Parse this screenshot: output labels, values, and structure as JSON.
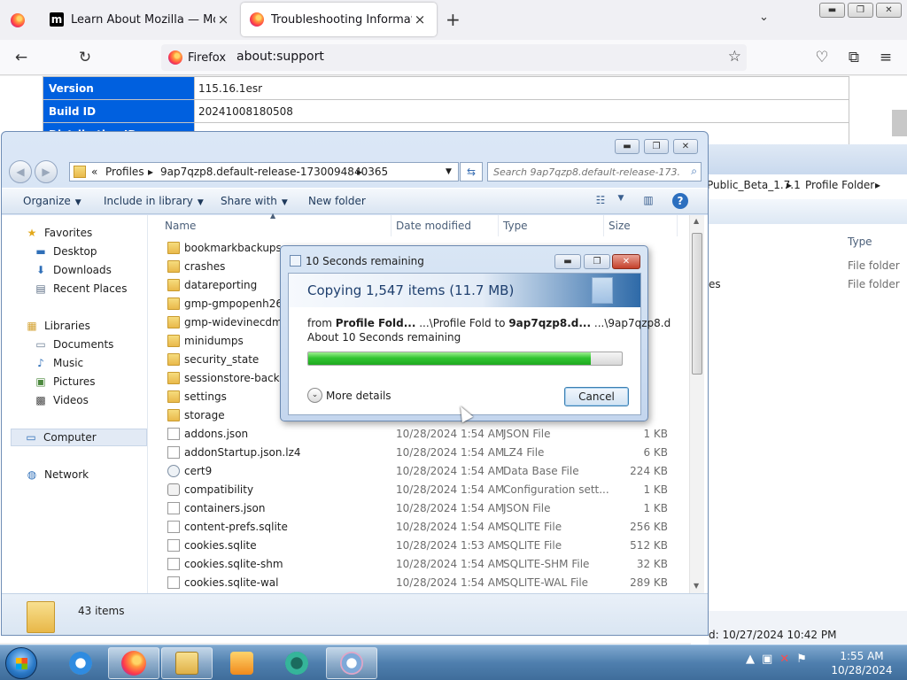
{
  "browser": {
    "tabs": [
      {
        "title": "Learn About Mozilla — Mozilla",
        "icon": "mozilla-m-icon"
      },
      {
        "title": "Troubleshooting Information",
        "icon": "firefox-icon"
      }
    ],
    "identity_label": "Firefox",
    "url": "about:support",
    "support_table": [
      {
        "label": "Version",
        "value": "115.16.1esr"
      },
      {
        "label": "Build ID",
        "value": "20241008180508"
      },
      {
        "label": "Distribution ID",
        "value": ""
      }
    ]
  },
  "background_explorer": {
    "address_tail": "Public_Beta_1.7.1",
    "address_last": "Profile Folder",
    "type_header": "Type",
    "rows": [
      {
        "name": "",
        "type": "File folder"
      },
      {
        "name": "es",
        "type": "File folder"
      }
    ],
    "status_text": "d: 10/27/2024 10:42 PM"
  },
  "explorer": {
    "address": {
      "prefix": "«",
      "parts": [
        "Profiles",
        "9ap7qzp8.default-release-1730094840365"
      ]
    },
    "search_placeholder": "Search 9ap7qzp8.default-release-173...",
    "toolbar": {
      "organize": "Organize",
      "include_in_library": "Include in library",
      "share_with": "Share with",
      "new_folder": "New folder"
    },
    "nav": {
      "favorites_header": "Favorites",
      "favorites": [
        "Desktop",
        "Downloads",
        "Recent Places"
      ],
      "libraries_header": "Libraries",
      "libraries": [
        "Documents",
        "Music",
        "Pictures",
        "Videos"
      ],
      "computer": "Computer",
      "network": "Network"
    },
    "columns": {
      "name": "Name",
      "date": "Date modified",
      "type": "Type",
      "size": "Size"
    },
    "files": [
      {
        "name": "bookmarkbackups",
        "date": "",
        "type": "",
        "size": "",
        "kind": "folder"
      },
      {
        "name": "crashes",
        "date": "",
        "type": "",
        "size": "",
        "kind": "folder"
      },
      {
        "name": "datareporting",
        "date": "",
        "type": "",
        "size": "",
        "kind": "folder"
      },
      {
        "name": "gmp-gmpopenh264",
        "date": "",
        "type": "",
        "size": "",
        "kind": "folder"
      },
      {
        "name": "gmp-widevinecdm",
        "date": "",
        "type": "",
        "size": "",
        "kind": "folder"
      },
      {
        "name": "minidumps",
        "date": "",
        "type": "",
        "size": "",
        "kind": "folder"
      },
      {
        "name": "security_state",
        "date": "",
        "type": "",
        "size": "",
        "kind": "folder"
      },
      {
        "name": "sessionstore-backups",
        "date": "",
        "type": "",
        "size": "",
        "kind": "folder"
      },
      {
        "name": "settings",
        "date": "",
        "type": "",
        "size": "",
        "kind": "folder"
      },
      {
        "name": "storage",
        "date": "",
        "type": "",
        "size": "",
        "kind": "folder"
      },
      {
        "name": "addons.json",
        "date": "10/28/2024 1:54 AM",
        "type": "JSON File",
        "size": "1 KB",
        "kind": "doc"
      },
      {
        "name": "addonStartup.json.lz4",
        "date": "10/28/2024 1:54 AM",
        "type": "LZ4 File",
        "size": "6 KB",
        "kind": "doc"
      },
      {
        "name": "cert9",
        "date": "10/28/2024 1:54 AM",
        "type": "Data Base File",
        "size": "224 KB",
        "kind": "cert"
      },
      {
        "name": "compatibility",
        "date": "10/28/2024 1:54 AM",
        "type": "Configuration sett...",
        "size": "1 KB",
        "kind": "gear"
      },
      {
        "name": "containers.json",
        "date": "10/28/2024 1:54 AM",
        "type": "JSON File",
        "size": "1 KB",
        "kind": "doc"
      },
      {
        "name": "content-prefs.sqlite",
        "date": "10/28/2024 1:54 AM",
        "type": "SQLITE File",
        "size": "256 KB",
        "kind": "doc"
      },
      {
        "name": "cookies.sqlite",
        "date": "10/28/2024 1:53 AM",
        "type": "SQLITE File",
        "size": "512 KB",
        "kind": "doc"
      },
      {
        "name": "cookies.sqlite-shm",
        "date": "10/28/2024 1:54 AM",
        "type": "SQLITE-SHM File",
        "size": "32 KB",
        "kind": "doc"
      },
      {
        "name": "cookies.sqlite-wal",
        "date": "10/28/2024 1:54 AM",
        "type": "SQLITE-WAL File",
        "size": "289 KB",
        "kind": "doc"
      }
    ],
    "status": "43 items"
  },
  "copy_dialog": {
    "title": "10 Seconds remaining",
    "heading": "Copying 1,547 items (11.7 MB)",
    "from_prefix": "from",
    "from_name": "Profile Fold...",
    "from_path": "...\\Profile Fold",
    "to_prefix": "to",
    "to_name": "9ap7qzp8.d...",
    "to_path": "...\\9ap7qzp8.d",
    "remaining": "About 10 Seconds remaining",
    "progress": 0.9,
    "more_details": "More details",
    "cancel": "Cancel"
  },
  "taskbar": {
    "apps": [
      "internet-explorer-icon",
      "firefox-icon",
      "file-explorer-icon",
      "media-player-icon",
      "chrome-like-icon",
      "paint-icon"
    ],
    "time": "1:55 AM",
    "date": "10/28/2024"
  },
  "colors": {
    "accent": "#0060df",
    "progress": "#31c532"
  }
}
